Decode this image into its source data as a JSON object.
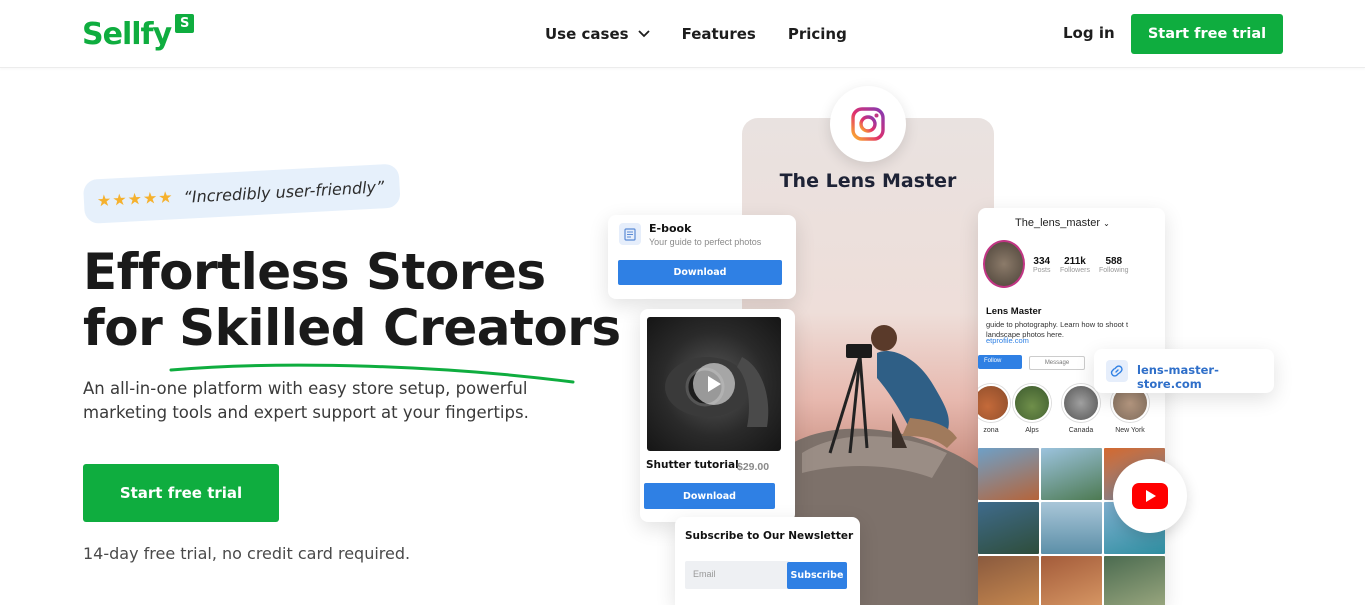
{
  "brand": {
    "name": "Sellfy",
    "badge": "S",
    "color": "#0fad3f"
  },
  "nav": {
    "items": [
      {
        "label": "Use cases",
        "has_dropdown": true
      },
      {
        "label": "Features",
        "has_dropdown": false
      },
      {
        "label": "Pricing",
        "has_dropdown": false
      }
    ],
    "login": "Log in",
    "cta": "Start free trial"
  },
  "hero": {
    "rating_stars": "★★★★★",
    "quote": "“Incredibly user-friendly”",
    "title_line1": "Effortless Stores",
    "title_line2_a": "for ",
    "title_line2_b": "Skilled Creators",
    "subtitle": "An all-in-one platform with easy store setup, powerful marketing tools and expert support at your fingertips.",
    "cta": "Start free trial",
    "note": "14-day free trial, no credit card required."
  },
  "collage": {
    "store_title": "The Lens Master",
    "ebook": {
      "title": "E-book",
      "subtitle": "Your guide to perfect photos",
      "button": "Download"
    },
    "video": {
      "title": "Shutter tutorial",
      "price": "$29.00",
      "button": "Download"
    },
    "newsletter": {
      "title": "Subscribe to Our Newsletter",
      "placeholder": "Email",
      "button": "Subscribe"
    },
    "profile": {
      "handle": "The_lens_master",
      "stats": [
        {
          "value": "334",
          "label": "Posts"
        },
        {
          "value": "211k",
          "label": "Followers"
        },
        {
          "value": "588",
          "label": "Following"
        }
      ],
      "name": "Lens Master",
      "bio": "guide to photography. Learn how to shoot t landscape photos here.",
      "link": "etprofile.com",
      "follow": "Follow",
      "message": "Message",
      "highlights": [
        "zona",
        "Alps",
        "Canada",
        "New York"
      ]
    },
    "store_link": "lens-master-store.com"
  },
  "icons": {
    "instagram": "instagram-icon",
    "youtube": "youtube-icon",
    "link": "link-icon",
    "ebook": "book-icon",
    "play": "play-icon",
    "chevron": "chevron-down-icon"
  },
  "colors": {
    "accent_green": "#0fad3f",
    "accent_blue": "#2f80e4",
    "quote_bg": "#e6f0fb",
    "star": "#f5b12e"
  }
}
